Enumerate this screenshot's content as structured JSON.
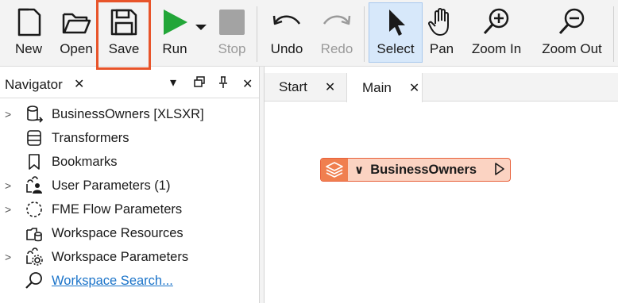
{
  "toolbar": {
    "new": "New",
    "open": "Open",
    "save": "Save",
    "run": "Run",
    "stop": "Stop",
    "undo": "Undo",
    "redo": "Redo",
    "select": "Select",
    "pan": "Pan",
    "zoom_in": "Zoom In",
    "zoom_out": "Zoom Out"
  },
  "colors": {
    "highlight": "#e8542a",
    "run_green": "#22a638",
    "node_fill": "#fbd3c2",
    "node_border": "#e8603a",
    "link": "#1a73c9"
  },
  "navigator": {
    "title": "Navigator",
    "items": [
      {
        "label": "BusinessOwners [XLSXR]",
        "icon": "reader-icon",
        "expandable": true
      },
      {
        "label": "Transformers",
        "icon": "transformers-icon",
        "expandable": false
      },
      {
        "label": "Bookmarks",
        "icon": "bookmark-icon",
        "expandable": false
      },
      {
        "label": "User Parameters (1)",
        "icon": "user-parameters-icon",
        "expandable": true
      },
      {
        "label": "FME Flow Parameters",
        "icon": "flow-parameters-icon",
        "expandable": true
      },
      {
        "label": "Workspace Resources",
        "icon": "resources-icon",
        "expandable": false
      },
      {
        "label": "Workspace Parameters",
        "icon": "workspace-parameters-icon",
        "expandable": true
      },
      {
        "label": "Workspace Search...",
        "icon": "search-icon",
        "expandable": false
      }
    ]
  },
  "tabs": [
    {
      "label": "Start"
    },
    {
      "label": "Main"
    }
  ],
  "canvas": {
    "node_label": "BusinessOwners"
  }
}
